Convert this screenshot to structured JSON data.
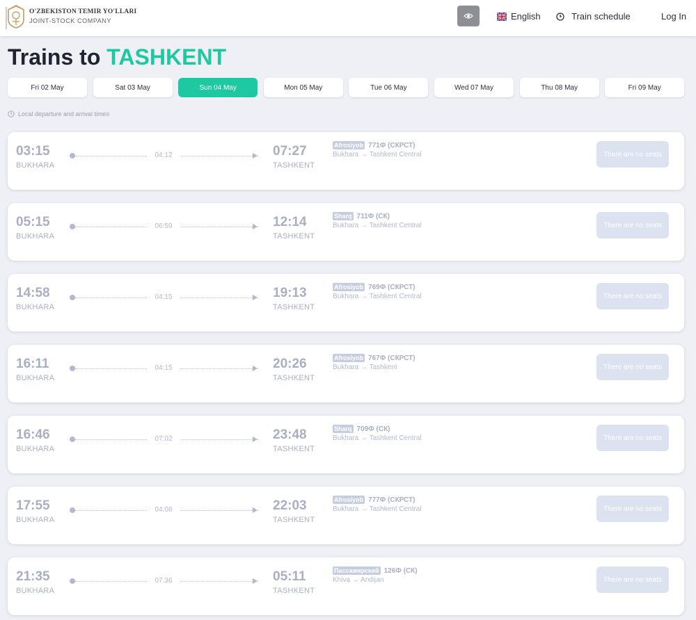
{
  "header": {
    "brand_line1": "O'ZBEKISTON TEMIR YO'LLARI",
    "brand_line2": "JOINT-STOCK COMPANY",
    "language": "English",
    "schedule": "Train schedule",
    "login": "Log In"
  },
  "title": {
    "prefix": "Trains to",
    "city": "TASHKENT"
  },
  "dates": [
    "Fri 02 May",
    "Sat 03 May",
    "Sun 04 May",
    "Mon 05 May",
    "Tue 06 May",
    "Wed 07 May",
    "Thu 08 May",
    "Fri 09 May"
  ],
  "active_date_index": 2,
  "note": "Local departure and arrival times",
  "trains": [
    {
      "dep_time": "03:15",
      "dep_city": "BUKHARA",
      "duration": "04:12",
      "arr_time": "07:27",
      "arr_city": "TASHKENT",
      "brand": "Afrosiyob",
      "number": "771Ф (СКРСТ)",
      "route": "Bukhara → Tashkent Central",
      "status": "There are no seats"
    },
    {
      "dep_time": "05:15",
      "dep_city": "BUKHARA",
      "duration": "06:59",
      "arr_time": "12:14",
      "arr_city": "TASHKENT",
      "brand": "Sharq",
      "number": "711Ф (СК)",
      "route": "Bukhara → Tashkent Central",
      "status": "There are no seats"
    },
    {
      "dep_time": "14:58",
      "dep_city": "BUKHARA",
      "duration": "04:15",
      "arr_time": "19:13",
      "arr_city": "TASHKENT",
      "brand": "Afrosiyob",
      "number": "769Ф (СКРСТ)",
      "route": "Bukhara → Tashkent Central",
      "status": "There are no seats"
    },
    {
      "dep_time": "16:11",
      "dep_city": "BUKHARA",
      "duration": "04:15",
      "arr_time": "20:26",
      "arr_city": "TASHKENT",
      "brand": "Afrosiyob",
      "number": "767Ф (СКРСТ)",
      "route": "Bukhara → Tashkent",
      "status": "There are no seats"
    },
    {
      "dep_time": "16:46",
      "dep_city": "BUKHARA",
      "duration": "07:02",
      "arr_time": "23:48",
      "arr_city": "TASHKENT",
      "brand": "Sharq",
      "number": "709Ф (СК)",
      "route": "Bukhara → Tashkent Central",
      "status": "There are no seats"
    },
    {
      "dep_time": "17:55",
      "dep_city": "BUKHARA",
      "duration": "04:08",
      "arr_time": "22:03",
      "arr_city": "TASHKENT",
      "brand": "Afrosiyob",
      "number": "777Ф (СКРСТ)",
      "route": "Bukhara → Tashkent Central",
      "status": "There are no seats"
    },
    {
      "dep_time": "21:35",
      "dep_city": "BUKHARA",
      "duration": "07:36",
      "arr_time": "05:11",
      "arr_city": "TASHKENT",
      "brand": "Пассажирский",
      "number": "126Ф (СК)",
      "route": "Khiva → Andijan",
      "status": "There are no seats"
    }
  ],
  "colors": {
    "accent": "#1ec8a0",
    "muted_text": "#a9afc3",
    "badge": "#c7cde0",
    "disabled_button": "#dde2f0"
  }
}
